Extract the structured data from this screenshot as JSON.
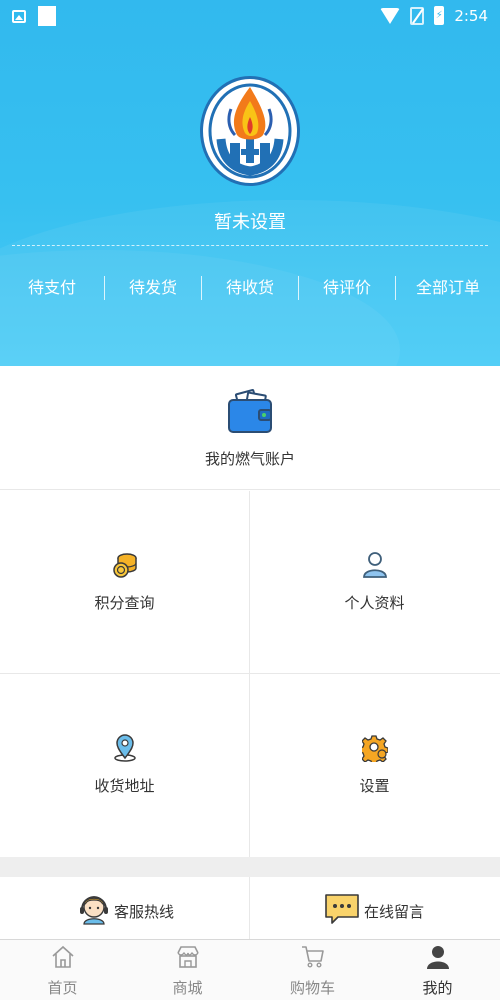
{
  "status_bar": {
    "time": "2:54",
    "battery_glyph": "⚡"
  },
  "profile": {
    "username": "暂未设置"
  },
  "orders": [
    {
      "label": "待支付"
    },
    {
      "label": "待发货"
    },
    {
      "label": "待收货"
    },
    {
      "label": "待评价"
    },
    {
      "label": "全部订单"
    }
  ],
  "wallet": {
    "label": "我的燃气账户",
    "icon": "wallet-icon"
  },
  "menu": [
    {
      "label": "积分查询",
      "icon": "coins-icon"
    },
    {
      "label": "个人资料",
      "icon": "user-icon"
    },
    {
      "label": "收货地址",
      "icon": "location-icon"
    },
    {
      "label": "设置",
      "icon": "gear-icon"
    }
  ],
  "service": {
    "hotline_label": "客服热线",
    "message_label": "在线留言"
  },
  "bottom_nav": [
    {
      "label": "首页",
      "icon": "home-icon"
    },
    {
      "label": "商城",
      "icon": "store-icon"
    },
    {
      "label": "购物车",
      "icon": "cart-icon"
    },
    {
      "label": "我的",
      "icon": "person-icon",
      "active": true
    }
  ],
  "colors": {
    "header_blue": "#35bdf0",
    "accent_gold": "#f5a623",
    "icon_blue": "#2b87e8"
  }
}
